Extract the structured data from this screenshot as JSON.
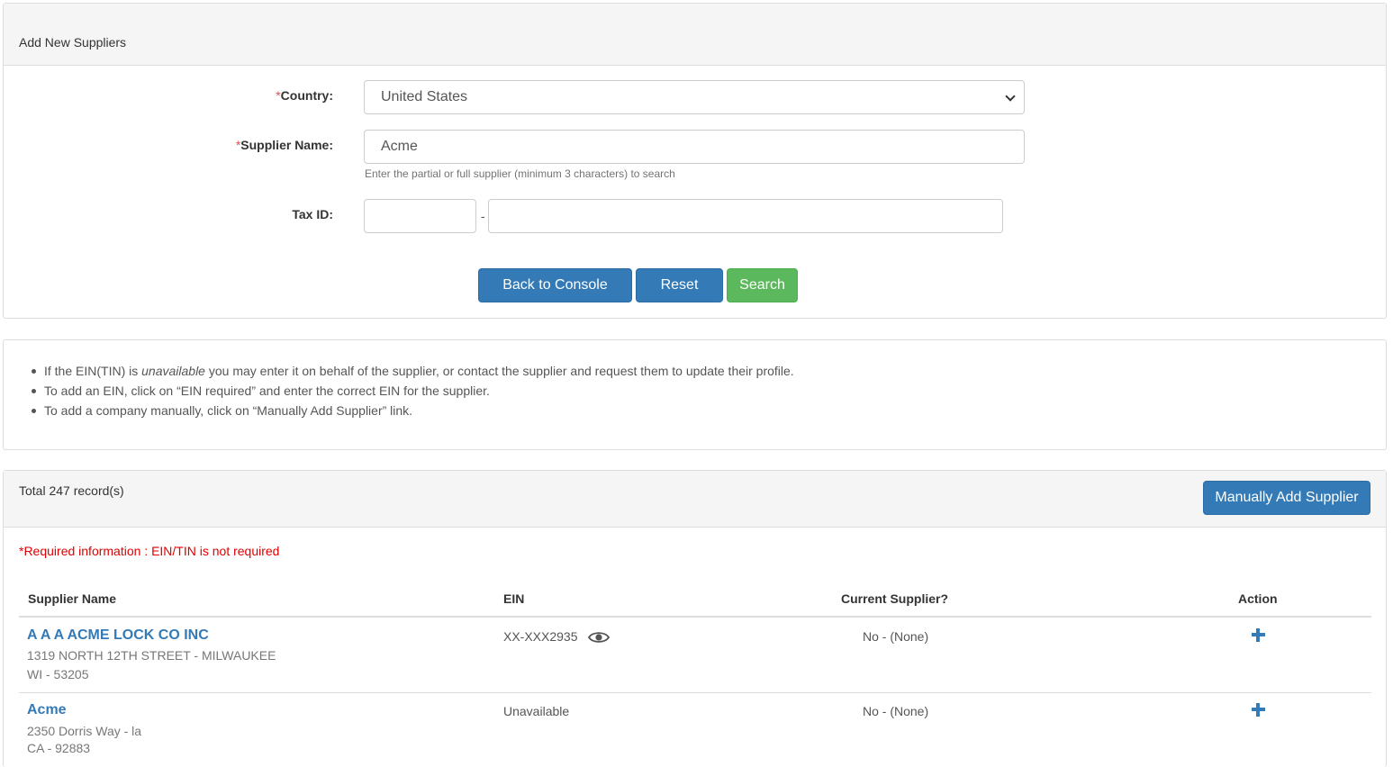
{
  "panel_add": {
    "title": "Add New Suppliers",
    "country": {
      "required_mark": "*",
      "label": "Country:",
      "value": "United States"
    },
    "supplier_name": {
      "required_mark": "*",
      "label": "Supplier Name:",
      "value": "Acme",
      "help": "Enter the partial or full supplier (minimum 3 characters) to search"
    },
    "tax_id": {
      "label": "Tax ID:",
      "part1": "",
      "separator": "-",
      "part2": ""
    },
    "buttons": {
      "back": "Back to Console",
      "reset": "Reset",
      "search": "Search"
    }
  },
  "info": {
    "line1_pre": "If the EIN(TIN) is ",
    "line1_em": "unavailable",
    "line1_post": " you may enter it on behalf of the supplier, or contact the supplier and request them to update their profile.",
    "line2": "To add an EIN, click on “EIN required” and enter the correct EIN for the supplier.",
    "line3": "To add a company manually, click on “Manually Add Supplier” link."
  },
  "results": {
    "total": "Total 247 record(s)",
    "manual_add": "Manually Add Supplier",
    "required_info": "*Required information : EIN/TIN is not required",
    "columns": {
      "name": "Supplier Name",
      "ein": "EIN",
      "current": "Current Supplier?",
      "action": "Action"
    },
    "rows": [
      {
        "name": "A A A ACME LOCK CO INC",
        "address1": "1319 NORTH 12TH STREET - MILWAUKEE",
        "address2": "WI - 53205",
        "ein": "XX-XXX2935",
        "current": "No - (None)"
      },
      {
        "name": "Acme",
        "address1": "2350 Dorris Way - la",
        "address2": "CA - 92883",
        "ein": "Unavailable",
        "current": "No - (None)"
      }
    ]
  },
  "colors": {
    "primary": "#337ab7",
    "success": "#5cb85c",
    "required": "#d9534f"
  }
}
